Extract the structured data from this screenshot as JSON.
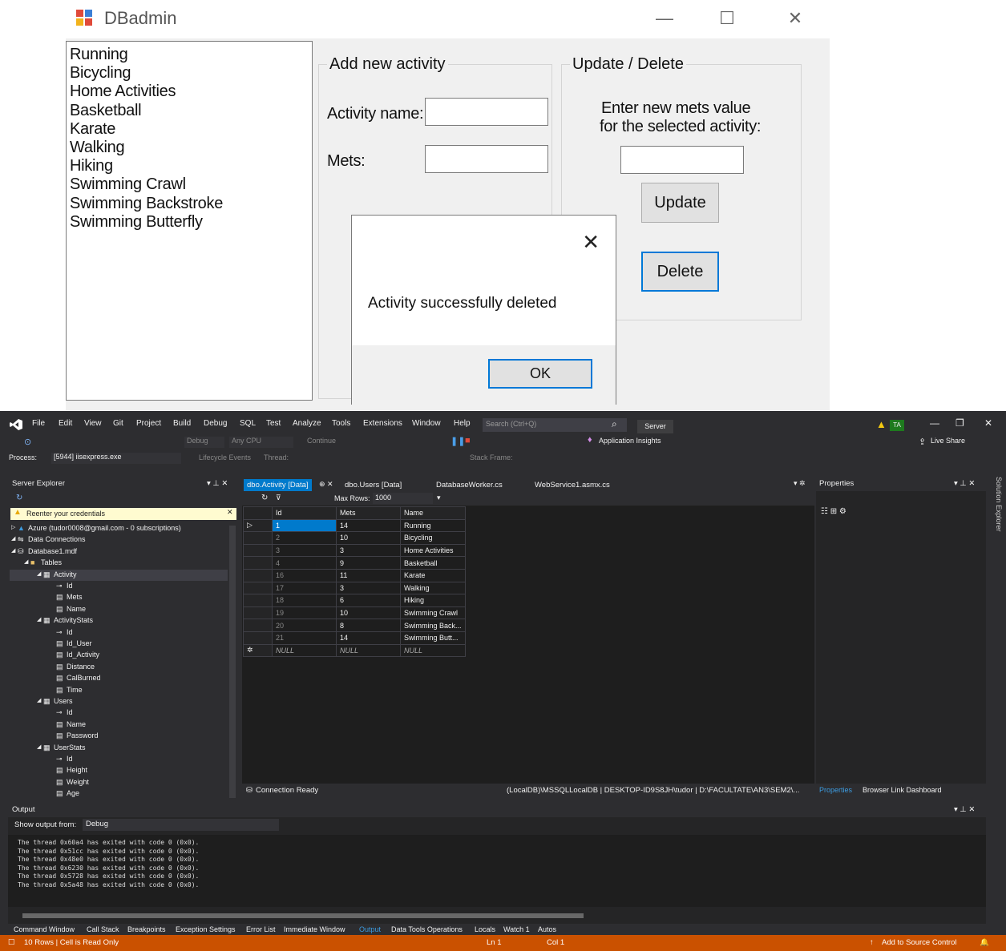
{
  "winform": {
    "title": "DBadmin",
    "controls": {
      "minimize": "—",
      "maximize": "☐",
      "close": "✕"
    },
    "activities": [
      "Running",
      "Bicycling",
      "Home Activities",
      "Basketball",
      "Karate",
      "Walking",
      "Hiking",
      "Swimming Crawl",
      "Swimming Backstroke",
      "Swimming Butterfly"
    ],
    "add_group": {
      "legend": "Add new activity",
      "name_label": "Activity name:",
      "mets_label": "Mets:",
      "name_value": "",
      "mets_value": ""
    },
    "update_group": {
      "legend": "Update / Delete",
      "prompt_line1": "Enter new mets value",
      "prompt_line2": "for the selected activity:",
      "mets_value": "",
      "update_label": "Update",
      "delete_label": "Delete"
    },
    "messagebox": {
      "text": "Activity successfully deleted",
      "ok_label": "OK",
      "close": "✕"
    }
  },
  "vs": {
    "menu": [
      "File",
      "Edit",
      "View",
      "Git",
      "Project",
      "Build",
      "Debug",
      "SQL",
      "Test",
      "Analyze",
      "Tools",
      "Extensions",
      "Window",
      "Help"
    ],
    "search_placeholder": "Search (Ctrl+Q)",
    "server_label": "Server",
    "user_initials": "TA",
    "live_share": "Live Share",
    "toolbar": {
      "config": "Debug",
      "platform": "Any CPU",
      "continue": "Continue",
      "app_insights": "Application Insights"
    },
    "process_bar": {
      "process_label": "Process:",
      "process_value": "[5944] iisexpress.exe",
      "lifecycle": "Lifecycle Events",
      "thread": "Thread:",
      "stack_frame": "Stack Frame:"
    },
    "server_explorer": {
      "title": "Server Explorer",
      "warning": "Reenter your credentials",
      "tree": [
        {
          "text": "Azure (tudor0008@gmail.com - 0 subscriptions)",
          "level": 0,
          "icon": "azure-icon"
        },
        {
          "text": "Data Connections",
          "level": 0,
          "icon": "connections-icon"
        },
        {
          "text": "Database1.mdf",
          "level": 1,
          "icon": "database-icon"
        },
        {
          "text": "Tables",
          "level": 2,
          "icon": "folder-icon"
        },
        {
          "text": "Activity",
          "level": 3,
          "icon": "table-icon"
        },
        {
          "text": "Id",
          "level": 4,
          "icon": "key-icon"
        },
        {
          "text": "Mets",
          "level": 4,
          "icon": "column-icon"
        },
        {
          "text": "Name",
          "level": 4,
          "icon": "column-icon"
        },
        {
          "text": "ActivityStats",
          "level": 3,
          "icon": "table-icon"
        },
        {
          "text": "Id",
          "level": 4,
          "icon": "key-icon"
        },
        {
          "text": "Id_User",
          "level": 4,
          "icon": "column-icon"
        },
        {
          "text": "Id_Activity",
          "level": 4,
          "icon": "column-icon"
        },
        {
          "text": "Distance",
          "level": 4,
          "icon": "column-icon"
        },
        {
          "text": "CalBurned",
          "level": 4,
          "icon": "column-icon"
        },
        {
          "text": "Time",
          "level": 4,
          "icon": "column-icon"
        },
        {
          "text": "Users",
          "level": 3,
          "icon": "table-icon"
        },
        {
          "text": "Id",
          "level": 4,
          "icon": "key-icon"
        },
        {
          "text": "Name",
          "level": 4,
          "icon": "column-icon"
        },
        {
          "text": "Password",
          "level": 4,
          "icon": "column-icon"
        },
        {
          "text": "UserStats",
          "level": 3,
          "icon": "table-icon"
        },
        {
          "text": "Id",
          "level": 4,
          "icon": "key-icon"
        },
        {
          "text": "Height",
          "level": 4,
          "icon": "column-icon"
        },
        {
          "text": "Weight",
          "level": 4,
          "icon": "column-icon"
        },
        {
          "text": "Age",
          "level": 4,
          "icon": "column-icon"
        }
      ]
    },
    "doc_tabs": [
      "dbo.Activity [Data]",
      "dbo.Users [Data]",
      "DatabaseWorker.cs",
      "WebService1.asmx.cs"
    ],
    "max_rows_label": "Max Rows:",
    "max_rows_value": "1000",
    "grid": {
      "columns": [
        "Id",
        "Mets",
        "Name"
      ],
      "rows": [
        [
          "1",
          "14",
          "Running"
        ],
        [
          "2",
          "10",
          "Bicycling"
        ],
        [
          "3",
          "3",
          "Home Activities"
        ],
        [
          "4",
          "9",
          "Basketball"
        ],
        [
          "16",
          "11",
          "Karate"
        ],
        [
          "17",
          "3",
          "Walking"
        ],
        [
          "18",
          "6",
          "Hiking"
        ],
        [
          "19",
          "10",
          "Swimming Crawl"
        ],
        [
          "20",
          "8",
          "Swimming Back..."
        ],
        [
          "21",
          "14",
          "Swimming Butt..."
        ],
        [
          "NULL",
          "NULL",
          "NULL"
        ]
      ]
    },
    "doc_status": {
      "left": "Connection Ready",
      "right": "(LocalDB)\\MSSQLLocalDB | DESKTOP-ID9S8JH\\tudor | D:\\FACULTATE\\AN3\\SEM2\\..."
    },
    "properties": {
      "title": "Properties",
      "tab1": "Properties",
      "tab2": "Browser Link Dashboard",
      "side_tab": "Solution Explorer"
    },
    "output": {
      "title": "Output",
      "show_from_label": "Show output from:",
      "show_from_value": "Debug",
      "lines": [
        "The thread 0x60a4 has exited with code 0 (0x0).",
        "The thread 0x51cc has exited with code 0 (0x0).",
        "The thread 0x48e0 has exited with code 0 (0x0).",
        "The thread 0x6230 has exited with code 0 (0x0).",
        "The thread 0x5728 has exited with code 0 (0x0).",
        "The thread 0x5a48 has exited with code 0 (0x0)."
      ]
    },
    "bottom_tabs": [
      "Command Window",
      "Call Stack",
      "Breakpoints",
      "Exception Settings",
      "Error List",
      "Immediate Window",
      "Output",
      "Data Tools Operations",
      "Locals",
      "Watch 1",
      "Autos"
    ],
    "status": {
      "left": "10 Rows | Cell is Read Only",
      "ln": "Ln 1",
      "col": "Col 1",
      "source_control": "Add to Source Control"
    },
    "colors": {
      "status_bar": "#ca5100",
      "accent": "#007acc",
      "background": "#2d2d30"
    }
  }
}
